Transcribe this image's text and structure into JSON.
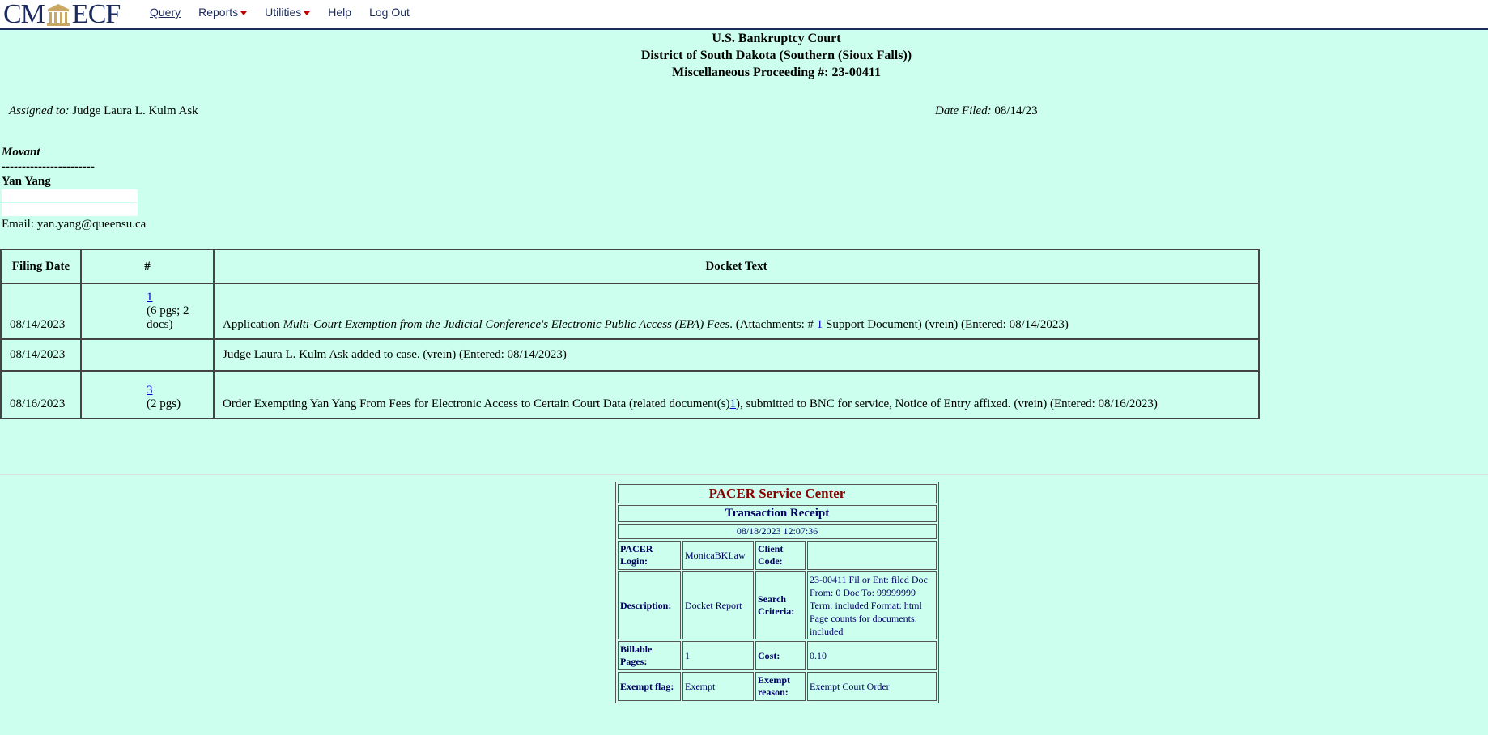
{
  "nav": {
    "logo_left": "CM",
    "logo_right": "ECF",
    "items": [
      "Query",
      "Reports",
      "Utilities",
      "Help",
      "Log Out"
    ]
  },
  "header": {
    "court": "U.S. Bankruptcy Court",
    "district": "District of South Dakota (Southern (Sioux Falls))",
    "case": "Miscellaneous Proceeding #: 23-00411"
  },
  "case_info": {
    "assigned_label": "Assigned to:",
    "assigned_value": "Judge Laura L. Kulm Ask",
    "filed_label": "Date Filed:",
    "filed_value": "08/14/23"
  },
  "party": {
    "role": "Movant",
    "dashes": "-----------------------",
    "name": "Yan Yang",
    "email": "Email: yan.yang@queensu.ca"
  },
  "docket": {
    "headers": [
      "Filing Date",
      "#",
      "Docket Text"
    ],
    "rows": [
      {
        "date": "08/14/2023",
        "num": "1",
        "pages": "(6 pgs; 2 docs)",
        "text_a": "Application ",
        "text_em": "Multi-Court Exemption from the Judicial Conference's Electronic Public Access (EPA) Fees",
        "text_b": ". (Attachments: # ",
        "link": "1",
        "text_c": " Support Document) (vrein) (Entered: 08/14/2023)"
      },
      {
        "date": "08/14/2023",
        "num": "",
        "pages": "",
        "text": "Judge Laura L. Kulm Ask added to case. (vrein) (Entered: 08/14/2023)"
      },
      {
        "date": "08/16/2023",
        "num": "3",
        "pages": "(2 pgs)",
        "text_a": "Order Exempting Yan Yang From Fees for Electronic Access to Certain Court Data (related document(s)",
        "link": "1",
        "text_c": "), submitted to BNC for service, Notice of Entry affixed. (vrein) (Entered: 08/16/2023)"
      }
    ]
  },
  "receipt": {
    "title": "PACER Service Center",
    "subtitle": "Transaction Receipt",
    "timestamp": "08/18/2023 12:07:36",
    "login_label": "PACER Login:",
    "login_value": "MonicaBKLaw",
    "client_label": "Client Code:",
    "client_value": "",
    "desc_label": "Description:",
    "desc_value": "Docket Report",
    "criteria_label": "Search Criteria:",
    "criteria_value": "23-00411 Fil or Ent: filed Doc From: 0 Doc To: 99999999 Term: included Format: html Page counts for documents: included",
    "pages_label": "Billable Pages:",
    "pages_value": "1",
    "cost_label": "Cost:",
    "cost_value": "0.10",
    "exempt_label": "Exempt flag:",
    "exempt_value": "Exempt",
    "reason_label": "Exempt reason:",
    "reason_value": "Exempt Court Order"
  }
}
